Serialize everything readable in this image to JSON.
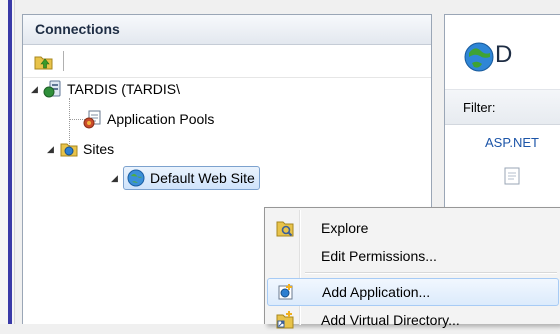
{
  "connections": {
    "title": "Connections",
    "tree": {
      "server": "TARDIS (TARDIS\\",
      "app_pools": "Application Pools",
      "sites": "Sites",
      "default_site": "Default Web Site"
    }
  },
  "right_panel": {
    "title": "D",
    "filter_label": "Filter:",
    "group_label": "ASP.NET"
  },
  "context_menu": {
    "items": [
      {
        "label": "Explore",
        "icon": "explore-folder-icon"
      },
      {
        "label": "Edit Permissions...",
        "icon": ""
      },
      {
        "label": "Add Application...",
        "icon": "add-application-icon"
      },
      {
        "label": "Add Virtual Directory...",
        "icon": "add-virtual-directory-icon"
      }
    ],
    "highlighted_item": "Add Application..."
  },
  "colors": {
    "accent_link": "#1c55a8",
    "selection_border": "#7da2ce",
    "menu_hover_border": "#a7cbf5"
  }
}
